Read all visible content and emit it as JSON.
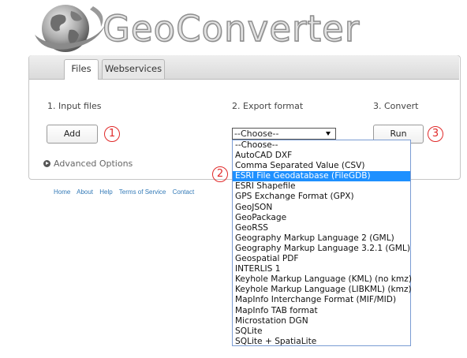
{
  "app": {
    "logo_text": "GeoConverter"
  },
  "tabs": [
    {
      "label": "Files",
      "active": true
    },
    {
      "label": "Webservices",
      "active": false
    }
  ],
  "steps": {
    "input": "1. Input files",
    "export": "2. Export format",
    "convert": "3. Convert"
  },
  "buttons": {
    "add": "Add",
    "run": "Run"
  },
  "markers": {
    "one": "1",
    "two": "2",
    "three": "3"
  },
  "advanced_label": "Advanced Options",
  "select": {
    "value": "--Choose--"
  },
  "format_options": [
    "--Choose--",
    "AutoCAD DXF",
    "Comma Separated Value (CSV)",
    "ESRI File Geodatabase (FileGDB)",
    "ESRI Shapefile",
    "GPS Exchange Format (GPX)",
    "GeoJSON",
    "GeoPackage",
    "GeoRSS",
    "Geography Markup Language 2 (GML)",
    "Geography Markup Language 3.2.1 (GML)",
    "Geospatial PDF",
    "INTERLIS 1",
    "Keyhole Markup Language (KML) (no kmz)",
    "Keyhole Markup Language (LIBKML) (kmz)",
    "MapInfo Interchange Format (MIF/MID)",
    "MapInfo TAB format",
    "Microstation DGN",
    "SQLite",
    "SQLite + SpatiaLite"
  ],
  "highlighted_option": "ESRI File Geodatabase (FileGDB)",
  "footer": {
    "links": [
      "Home",
      "About",
      "Help",
      "Terms of Service",
      "Contact"
    ]
  },
  "colors": {
    "marker": "#e02a2a",
    "highlight": "#1e90ff",
    "link": "#337ab7"
  }
}
